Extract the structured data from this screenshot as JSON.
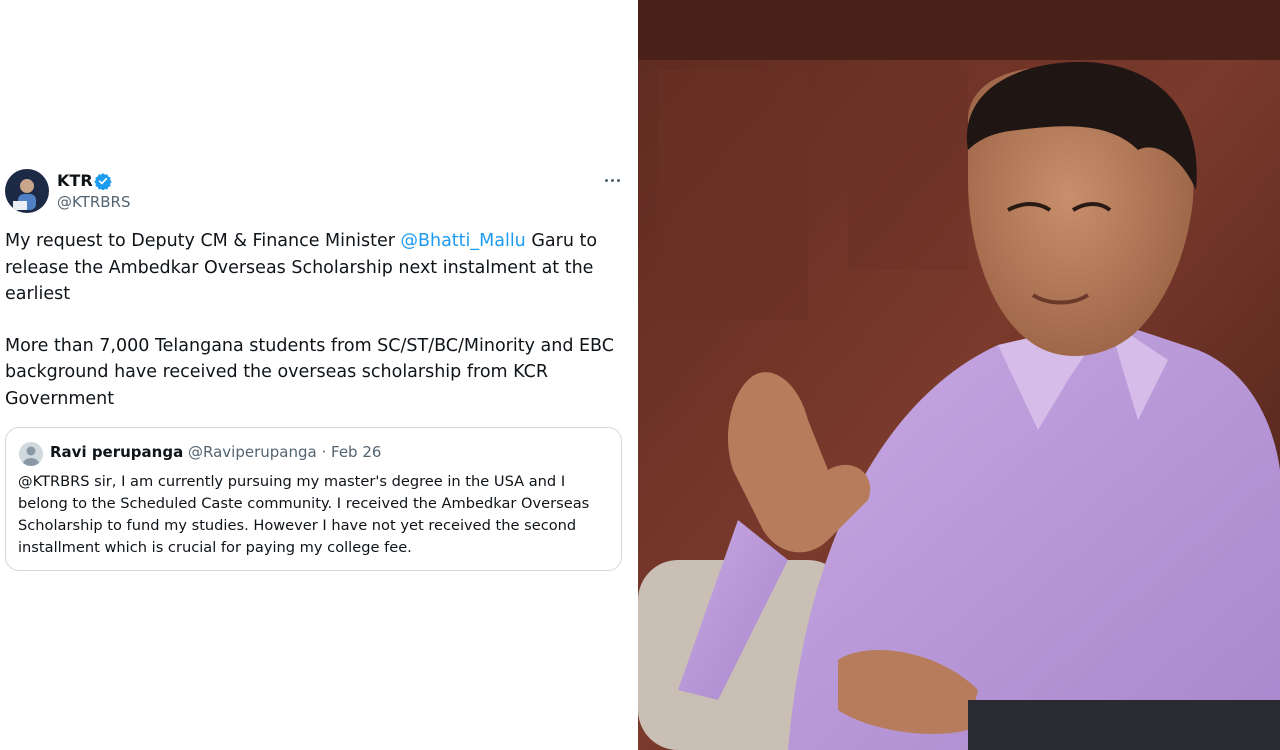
{
  "tweet": {
    "author_name": "KTR",
    "author_handle": "@KTRBRS",
    "body_p1_before": "My request to Deputy CM & Finance Minister ",
    "body_p1_mention": "@Bhatti_Mallu",
    "body_p1_after": " Garu to release the Ambedkar Overseas Scholarship next instalment at the earliest",
    "body_p2": "More than 7,000 Telangana students from SC/ST/BC/Minority and EBC background have received the overseas scholarship from KCR Government"
  },
  "quoted_tweet": {
    "author_name": "Ravi perupanga",
    "author_handle": "@Raviperupanga",
    "separator": "·",
    "date": "Feb 26",
    "text": "@KTRBRS sir, I am currently pursuing my master's degree in the USA and I belong to the Scheduled Caste  community. I received the Ambedkar Overseas Scholarship to fund my studies. However I have not yet received the second installment which is crucial for paying my college fee."
  },
  "icons": {
    "verified": "verified-badge-icon",
    "more": "more-options-icon",
    "verified_color": "#1d9bf0"
  },
  "photo": {
    "subject": "portrait-photo",
    "shirt_color": "#b89ad6",
    "background_color": "#6a2f24"
  }
}
